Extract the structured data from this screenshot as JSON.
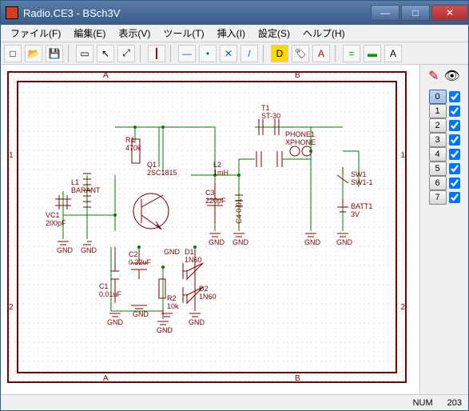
{
  "window": {
    "title": "Radio.CE3 - BSch3V"
  },
  "menu": {
    "file": "ファイル(F)",
    "edit": "編集(E)",
    "view": "表示(V)",
    "tool": "ツール(T)",
    "insert": "挿入(I)",
    "set": "設定(S)",
    "help": "ヘルプ(H)"
  },
  "toolbar_icons": {
    "new": "□",
    "open": "📂",
    "save": "💾",
    "sel": "▭",
    "arrow": "↖",
    "move": "⤢",
    "bus": "┃",
    "dash": "—",
    "junc": "•",
    "x": "✕",
    "diag": "/",
    "lbl": "D",
    "tag": "🏷",
    "a1": "A",
    "eq": "=",
    "rect": "▬",
    "a2": "A"
  },
  "ruler": {
    "a": "A",
    "b": "B",
    "n1": "1",
    "n2": "2"
  },
  "schematic": {
    "R1": {
      "ref": "R1",
      "val": "470k"
    },
    "Q1": {
      "ref": "Q1",
      "val": "2SC1815"
    },
    "L1": {
      "ref": "L1",
      "val": "BARANT"
    },
    "VC1": {
      "ref": "VC1",
      "val": "200pF"
    },
    "C1": {
      "ref": "C1",
      "val": "0.01uF"
    },
    "C2": {
      "ref": "C2",
      "val": "0.22uF"
    },
    "R2": {
      "ref": "R2",
      "val": "10k"
    },
    "D1": {
      "ref": "D1",
      "val": "1N60"
    },
    "D2": {
      "ref": "D2",
      "val": "1N60"
    },
    "C3": {
      "ref": "C3",
      "val": "220pF"
    },
    "L2": {
      "ref": "L2",
      "val": "1mH"
    },
    "C4": {
      "ref": "C4",
      "val": "0.01"
    },
    "T1": {
      "ref": "T1",
      "val": "ST-30"
    },
    "PH": {
      "ref": "PHONE1",
      "val": "XPHONE"
    },
    "SW1": {
      "ref": "SW1",
      "val": "SW1-1"
    },
    "BATT": {
      "ref": "BATT1",
      "val": "3V"
    },
    "GND": "GND"
  },
  "layers": {
    "pencil": "✎",
    "eye": "👁",
    "items": [
      "0",
      "1",
      "2",
      "3",
      "4",
      "5",
      "6",
      "7"
    ],
    "active": 0,
    "checked": [
      true,
      true,
      true,
      true,
      true,
      true,
      true,
      true
    ]
  },
  "status": {
    "num": "NUM",
    "coord": "203"
  }
}
